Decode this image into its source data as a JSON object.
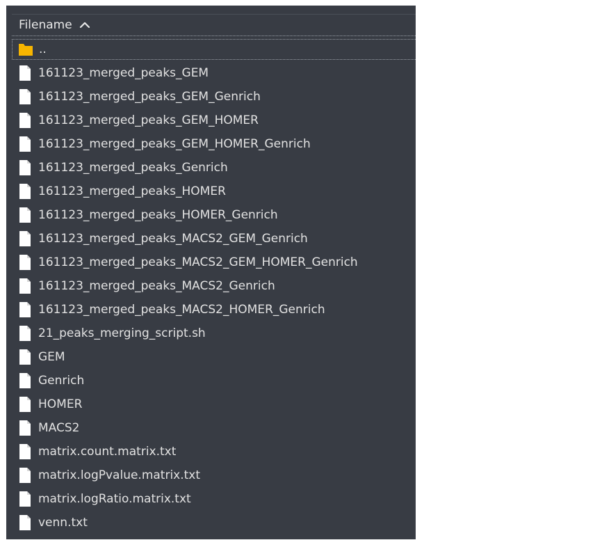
{
  "colors": {
    "panel_bg": "#383c44",
    "text": "#e2e2e2",
    "folder": "#f7b500",
    "file": "#ffffff"
  },
  "header": {
    "column_label": "Filename",
    "sort_icon": "chevron-up-icon"
  },
  "parent_row": {
    "label": "..",
    "icon": "folder-icon"
  },
  "files": [
    {
      "name": "161123_merged_peaks_GEM",
      "icon": "file-icon"
    },
    {
      "name": "161123_merged_peaks_GEM_Genrich",
      "icon": "file-icon"
    },
    {
      "name": "161123_merged_peaks_GEM_HOMER",
      "icon": "file-icon"
    },
    {
      "name": "161123_merged_peaks_GEM_HOMER_Genrich",
      "icon": "file-icon"
    },
    {
      "name": "161123_merged_peaks_Genrich",
      "icon": "file-icon"
    },
    {
      "name": "161123_merged_peaks_HOMER",
      "icon": "file-icon"
    },
    {
      "name": "161123_merged_peaks_HOMER_Genrich",
      "icon": "file-icon"
    },
    {
      "name": "161123_merged_peaks_MACS2_GEM_Genrich",
      "icon": "file-icon"
    },
    {
      "name": "161123_merged_peaks_MACS2_GEM_HOMER_Genrich",
      "icon": "file-icon"
    },
    {
      "name": "161123_merged_peaks_MACS2_Genrich",
      "icon": "file-icon"
    },
    {
      "name": "161123_merged_peaks_MACS2_HOMER_Genrich",
      "icon": "file-icon"
    },
    {
      "name": "21_peaks_merging_script.sh",
      "icon": "file-icon"
    },
    {
      "name": "GEM",
      "icon": "file-icon"
    },
    {
      "name": "Genrich",
      "icon": "file-icon"
    },
    {
      "name": "HOMER",
      "icon": "file-icon"
    },
    {
      "name": "MACS2",
      "icon": "file-icon"
    },
    {
      "name": "matrix.count.matrix.txt",
      "icon": "file-icon"
    },
    {
      "name": "matrix.logPvalue.matrix.txt",
      "icon": "file-icon"
    },
    {
      "name": "matrix.logRatio.matrix.txt",
      "icon": "file-icon"
    },
    {
      "name": "venn.txt",
      "icon": "file-icon"
    }
  ]
}
